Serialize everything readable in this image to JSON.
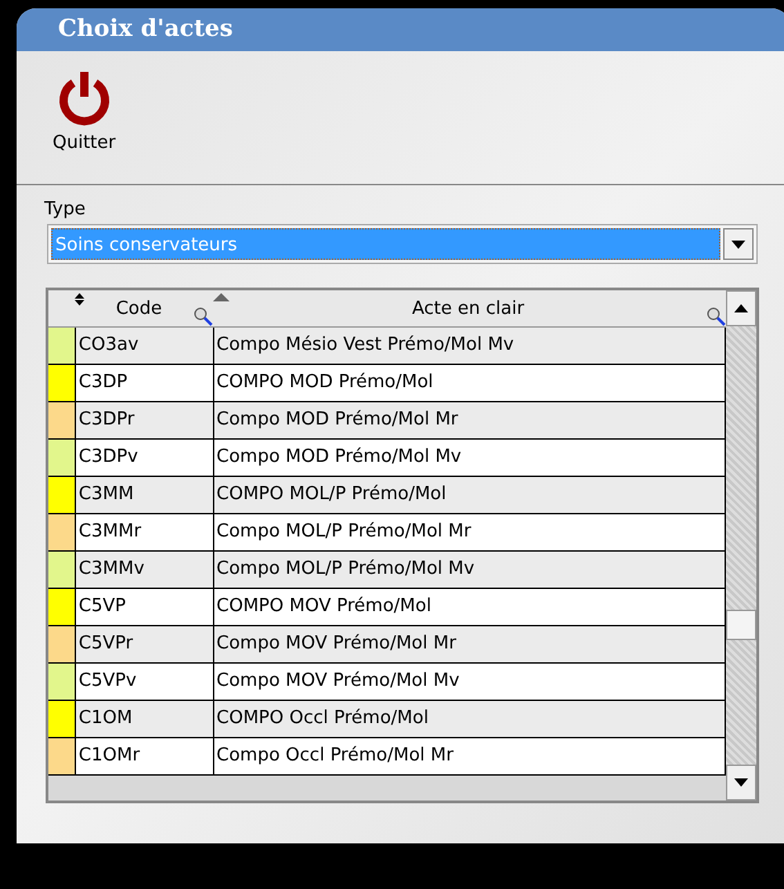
{
  "window": {
    "title": "Choix d'actes"
  },
  "toolbar": [
    {
      "kind": "power",
      "label": "Quitter"
    }
  ],
  "type_field": {
    "label": "Type",
    "value": "Soins conservateurs"
  },
  "table": {
    "columns": [
      {
        "label": "Code",
        "kind": "updown"
      },
      {
        "label": "Acte en clair",
        "kind": "up"
      }
    ],
    "rows": [
      {
        "color": "#e2f68c",
        "code": "CO3av",
        "acte": "Compo Mésio Vest Prémo/Mol Mv"
      },
      {
        "color": "#ffff00",
        "code": "C3DP",
        "acte": "COMPO MOD Prémo/Mol"
      },
      {
        "color": "#fcd98a",
        "code": "C3DPr",
        "acte": "Compo MOD Prémo/Mol Mr"
      },
      {
        "color": "#e2f68c",
        "code": "C3DPv",
        "acte": "Compo MOD Prémo/Mol Mv"
      },
      {
        "color": "#ffff00",
        "code": "C3MM",
        "acte": "COMPO MOL/P Prémo/Mol"
      },
      {
        "color": "#fcd98a",
        "code": "C3MMr",
        "acte": "Compo MOL/P Prémo/Mol Mr"
      },
      {
        "color": "#e2f68c",
        "code": "C3MMv",
        "acte": "Compo MOL/P Prémo/Mol Mv"
      },
      {
        "color": "#ffff00",
        "code": "C5VP",
        "acte": "COMPO MOV Prémo/Mol"
      },
      {
        "color": "#fcd98a",
        "code": "C5VPr",
        "acte": "Compo MOV Prémo/Mol Mr"
      },
      {
        "color": "#e2f68c",
        "code": "C5VPv",
        "acte": "Compo MOV Prémo/Mol Mv"
      },
      {
        "color": "#ffff00",
        "code": "C1OM",
        "acte": "COMPO Occl Prémo/Mol"
      },
      {
        "color": "#fcd98a",
        "code": "C1OMr",
        "acte": "Compo Occl Prémo/Mol Mr"
      }
    ]
  }
}
